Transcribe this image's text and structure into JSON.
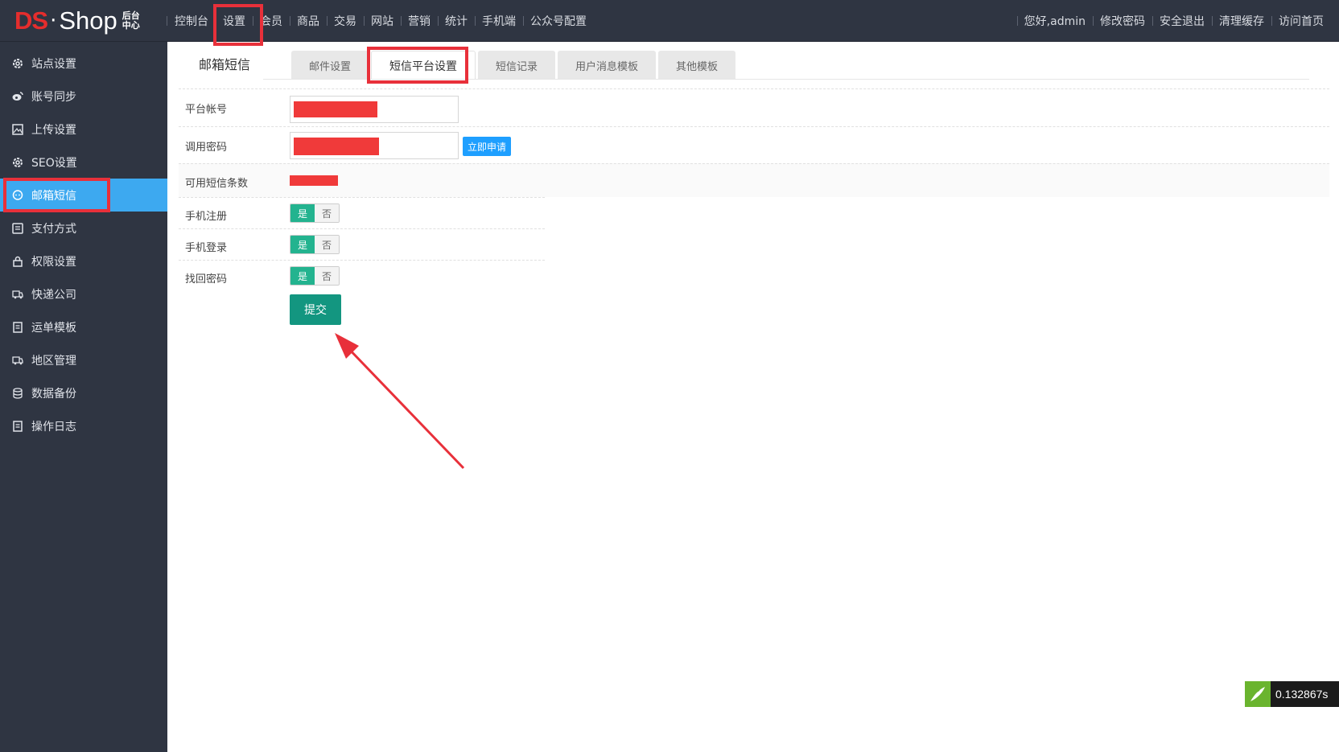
{
  "brand": {
    "logo_ds": "DS",
    "logo_dot": "·",
    "logo_shop": "Shop",
    "logo_sub1": "后台",
    "logo_sub2": "中心"
  },
  "topnav": [
    "控制台",
    "设置",
    "会员",
    "商品",
    "交易",
    "网站",
    "营销",
    "统计",
    "手机端",
    "公众号配置"
  ],
  "topright": [
    "您好,admin",
    "修改密码",
    "安全退出",
    "清理缓存",
    "访问首页"
  ],
  "sidebar": [
    {
      "label": "站点设置",
      "icon": "gear-icon"
    },
    {
      "label": "账号同步",
      "icon": "weibo-icon"
    },
    {
      "label": "上传设置",
      "icon": "image-icon"
    },
    {
      "label": "SEO设置",
      "icon": "gear-icon"
    },
    {
      "label": "邮箱短信",
      "icon": "chat-icon",
      "active": true
    },
    {
      "label": "支付方式",
      "icon": "wallet-icon"
    },
    {
      "label": "权限设置",
      "icon": "lock-icon"
    },
    {
      "label": "快递公司",
      "icon": "truck-icon"
    },
    {
      "label": "运单模板",
      "icon": "doc-icon"
    },
    {
      "label": "地区管理",
      "icon": "truck-icon"
    },
    {
      "label": "数据备份",
      "icon": "database-icon"
    },
    {
      "label": "操作日志",
      "icon": "doc-icon"
    }
  ],
  "page": {
    "title": "邮箱短信",
    "tabs": [
      {
        "label": "邮件设置"
      },
      {
        "label": "短信平台设置",
        "active": true
      },
      {
        "label": "短信记录"
      },
      {
        "label": "用户消息模板"
      },
      {
        "label": "其他模板"
      }
    ]
  },
  "form": {
    "account_label": "平台帐号",
    "password_label": "调用密码",
    "apply_button": "立即申请",
    "available_label": "可用短信条数",
    "mobile_register_label": "手机注册",
    "mobile_login_label": "手机登录",
    "recover_password_label": "找回密码",
    "yes": "是",
    "no": "否",
    "submit": "提交"
  },
  "perf": {
    "time": "0.132867s"
  },
  "colors": {
    "accent": "#3da9f0",
    "highlight": "#e8303a",
    "submit": "#139680",
    "toggle_on": "#23b38f"
  }
}
